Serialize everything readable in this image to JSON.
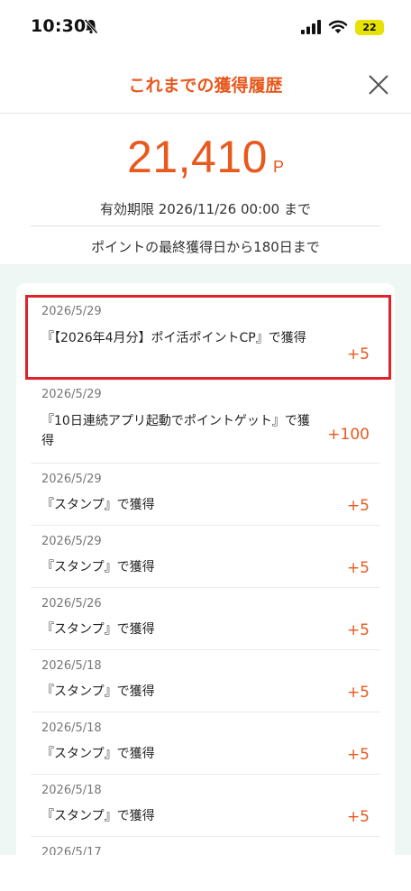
{
  "status": {
    "time": "10:30",
    "battery": "22"
  },
  "header": {
    "title": "これまでの獲得履歴"
  },
  "summary": {
    "points": "21,410",
    "unit": "P",
    "expiry": "有効期限 2026/11/26 00:00 まで",
    "expiry_note": "ポイントの最終獲得日から180日まで"
  },
  "entries": [
    {
      "date": "2026/5/29",
      "desc": "『【2026年4月分】ポイ活ポイントCP』で獲得",
      "points": "+5"
    },
    {
      "date": "2026/5/29",
      "desc": "『10日連続アプリ起動でポイントゲット』で獲得",
      "points": "+100"
    },
    {
      "date": "2026/5/29",
      "desc": "『スタンプ』で獲得",
      "points": "+5"
    },
    {
      "date": "2026/5/29",
      "desc": "『スタンプ』で獲得",
      "points": "+5"
    },
    {
      "date": "2026/5/26",
      "desc": "『スタンプ』で獲得",
      "points": "+5"
    },
    {
      "date": "2026/5/18",
      "desc": "『スタンプ』で獲得",
      "points": "+5"
    },
    {
      "date": "2026/5/18",
      "desc": "『スタンプ』で獲得",
      "points": "+5"
    },
    {
      "date": "2026/5/18",
      "desc": "『スタンプ』で獲得",
      "points": "+5"
    },
    {
      "date": "2026/5/17",
      "desc": "",
      "points": ""
    }
  ],
  "colors": {
    "accent": "#e8591e",
    "list_bg": "#eef7f3",
    "highlight": "#e0232a"
  },
  "icons": {
    "close": "close-icon",
    "bell": "bell-slash-icon",
    "signal": "signal-icon",
    "wifi": "wifi-icon",
    "battery": "battery-icon"
  }
}
